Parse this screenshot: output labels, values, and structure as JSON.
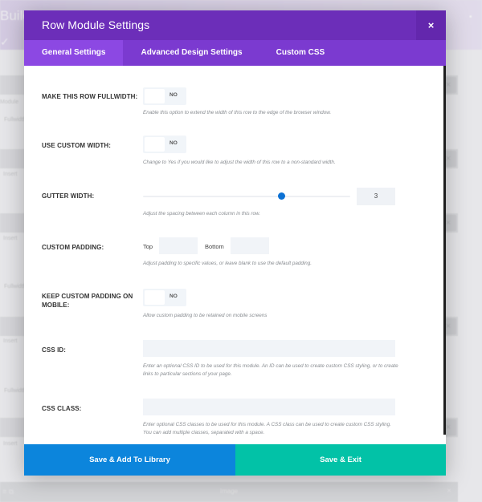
{
  "background": {
    "app_title_fragment": "Builde",
    "check_glyph": "✓",
    "rows": [
      {
        "type": "bar",
        "x_icon": "×"
      },
      {
        "type": "text",
        "text": "Module"
      },
      {
        "type": "text",
        "text": "Fullwidth"
      },
      {
        "type": "bar",
        "x_icon": "×"
      },
      {
        "type": "text",
        "text": "Insert"
      },
      {
        "type": "bar",
        "x_icon": "×"
      },
      {
        "type": "text",
        "text": "Insert"
      },
      {
        "type": "text",
        "text": "Fullwidth"
      },
      {
        "type": "bar",
        "x_icon": "×"
      },
      {
        "type": "text",
        "text": "Insert"
      },
      {
        "type": "text",
        "text": "Fullwidth"
      },
      {
        "type": "bar",
        "x_icon": "×"
      },
      {
        "type": "text",
        "text": "Insert"
      }
    ],
    "footer_row": {
      "label": "Image",
      "icon": "≡ ⧉",
      "x_icon": "×"
    }
  },
  "modal": {
    "title": "Row Module Settings",
    "close_icon": "×",
    "tabs": [
      {
        "label": "General Settings",
        "active": true
      },
      {
        "label": "Advanced Design Settings",
        "active": false
      },
      {
        "label": "Custom CSS",
        "active": false
      }
    ],
    "fields": {
      "fullwidth": {
        "label": "Make This Row Fullwidth:",
        "value": "NO",
        "description": "Enable this option to extend the width of this row to the edge of the browser window."
      },
      "custom_width": {
        "label": "Use Custom Width:",
        "value": "NO",
        "description": "Change to Yes if you would like to adjust the width of this row to a non-standard width."
      },
      "gutter_width": {
        "label": "Gutter Width:",
        "value": "3",
        "min": 1,
        "max": 4,
        "description": "Adjust the spacing between each column in this row."
      },
      "custom_padding": {
        "label": "Custom Padding:",
        "top_label": "Top",
        "top_value": "",
        "bottom_label": "Bottom",
        "bottom_value": "",
        "description": "Adjust padding to specific values, or leave blank to use the default padding."
      },
      "keep_padding_mobile": {
        "label": "Keep Custom Padding On Mobile:",
        "value": "NO",
        "description": "Allow custom padding to be retained on mobile screens"
      },
      "css_id": {
        "label": "CSS ID:",
        "value": "",
        "description": "Enter an optional CSS ID to be used for this module. An ID can be used to create custom CSS styling, or to create links to particular sections of your page."
      },
      "css_class": {
        "label": "CSS Class:",
        "value": "",
        "description": "Enter optional CSS classes to be used for this module. A CSS class can be used to create custom CSS styling. You can add multiple classes, separated with a space."
      }
    },
    "footer": {
      "save_library_label": "Save & Add To Library",
      "save_exit_label": "Save & Exit"
    }
  },
  "colors": {
    "header": "#6c2eb9",
    "tabs_bar": "#7b3ad0",
    "active_tab": "#8c48e3",
    "slider_accent": "#0c71d4",
    "library_button": "#0c85dc",
    "exit_button": "#02c2a7"
  }
}
